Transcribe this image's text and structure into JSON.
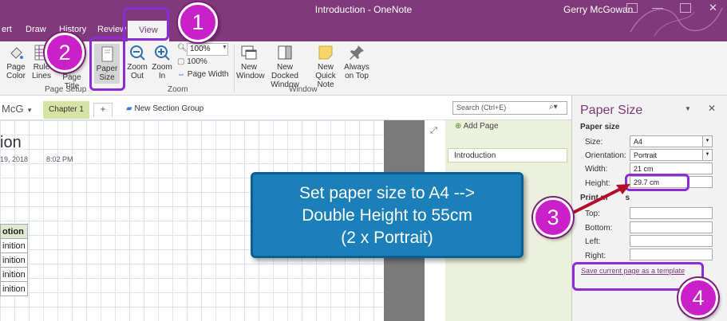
{
  "window": {
    "title": "Introduction  -  OneNote",
    "user": "Gerry McGowan"
  },
  "tabs": [
    "ert",
    "Draw",
    "History",
    "Review",
    "View"
  ],
  "ribbon": {
    "page_color": "Page\nColor",
    "rule_lines": "Rule\nLines",
    "page_title": "Page Title",
    "paper_size": "Paper\nSize",
    "zoom_out": "Zoom\nOut",
    "zoom_in": "Zoom\nIn",
    "zoom_value": "100%",
    "zoom_100": "100%",
    "page_width": "Page Width",
    "new_window": "New\nWindow",
    "new_docked_window": "New Docked\nWindow",
    "new_quick_note": "New Quick\nNote",
    "always_on_top": "Always\non Top",
    "groups": {
      "page_setup": "Page Setup",
      "zoom": "Zoom",
      "window": "Window"
    }
  },
  "notebook": {
    "name": "McG",
    "section_tab": "Chapter 1",
    "add_tab": "+",
    "new_section_group": "New Section Group",
    "search_placeholder": "Search (Ctrl+E)"
  },
  "page": {
    "title": "ion",
    "date": "19, 2018",
    "time": "8:02 PM",
    "table": [
      "otion",
      "inition",
      "inition",
      "inition",
      "inition"
    ]
  },
  "pagelist": {
    "add_page": "Add Page",
    "items": [
      "Introduction"
    ]
  },
  "pane": {
    "title": "Paper Size",
    "paper_size_heading": "Paper size",
    "size_label": "Size:",
    "size_value": "A4",
    "orientation_label": "Orientation:",
    "orientation_value": "Portrait",
    "width_label": "Width:",
    "width_value": "21 cm",
    "height_label": "Height:",
    "height_value": "29.7 cm",
    "print_margins_heading": "Print m",
    "margins_heading_tail": "s",
    "top_label": "Top:",
    "bottom_label": "Bottom:",
    "left_label": "Left:",
    "right_label": "Right:",
    "template_link": "Save current page as a template"
  },
  "callout": {
    "line1": "Set paper size to A4 -->",
    "line2": "Double Height to 55cm",
    "line3": "(2 x Portrait)"
  },
  "steps": [
    "1",
    "2",
    "3",
    "4"
  ],
  "colors": {
    "accent": "#80397b",
    "callout": "#1b7fb9",
    "step_circle": "#c920c9",
    "highlight": "#8b2cd6",
    "arrow": "#b0102a"
  }
}
